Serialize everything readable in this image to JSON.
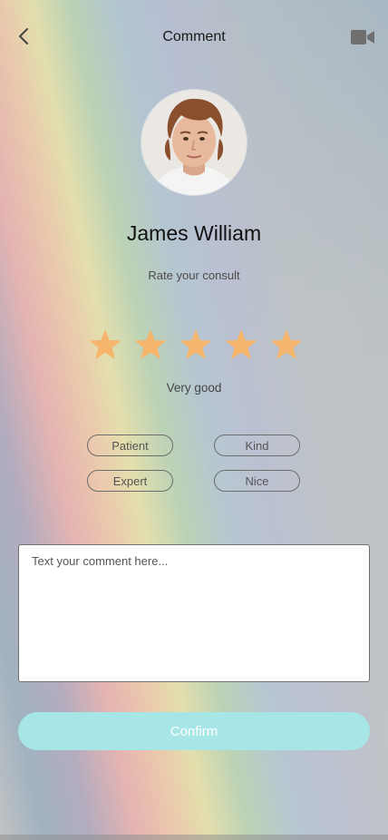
{
  "header": {
    "title": "Comment",
    "back_icon": "chevron-left-icon",
    "video_icon": "video-camera-icon"
  },
  "doctor": {
    "name": "James William"
  },
  "rating": {
    "prompt": "Rate your consult",
    "stars_total": 5,
    "stars_filled": 5,
    "label": "Very good",
    "star_color": "#f5b56d"
  },
  "tags": [
    "Patient",
    "Kind",
    "Expert",
    "Nice"
  ],
  "comment": {
    "placeholder": "Text your comment here...",
    "value": ""
  },
  "confirm": {
    "label": "Confirm",
    "color": "#a6e6e6"
  }
}
